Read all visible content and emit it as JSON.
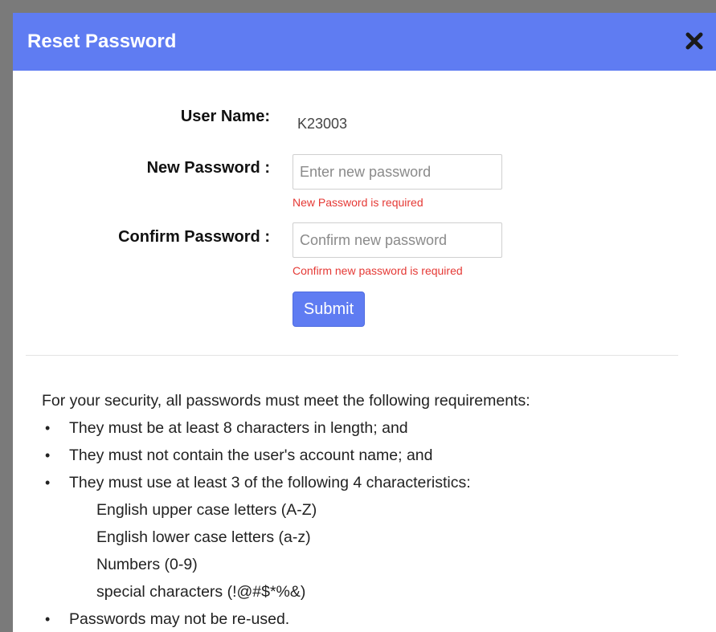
{
  "dialog": {
    "title": "Reset Password",
    "close_icon": "close-icon",
    "header_color": "#5f7cf2"
  },
  "form": {
    "username_label": "User Name:",
    "username_value": "K23003",
    "new_password": {
      "label": "New Password :",
      "placeholder": "Enter new password",
      "error": "New Password is required"
    },
    "confirm_password": {
      "label": "Confirm Password :",
      "placeholder": "Confirm new password",
      "error": "Confirm new password is required"
    },
    "submit_label": "Submit"
  },
  "requirements": {
    "intro": "For your security, all passwords must meet the following requirements:",
    "items": [
      "They must be at least 8 characters in length; and",
      "They must not contain the user's account name; and",
      "They must use at least 3 of the following 4 characteristics:"
    ],
    "characteristics": [
      "English upper case letters (A-Z)",
      "English lower case letters (a-z)",
      "Numbers (0-9)",
      "special characters (!@#$*%&)"
    ],
    "last_item": "Passwords may not be re-used.",
    "bullet": "•"
  }
}
